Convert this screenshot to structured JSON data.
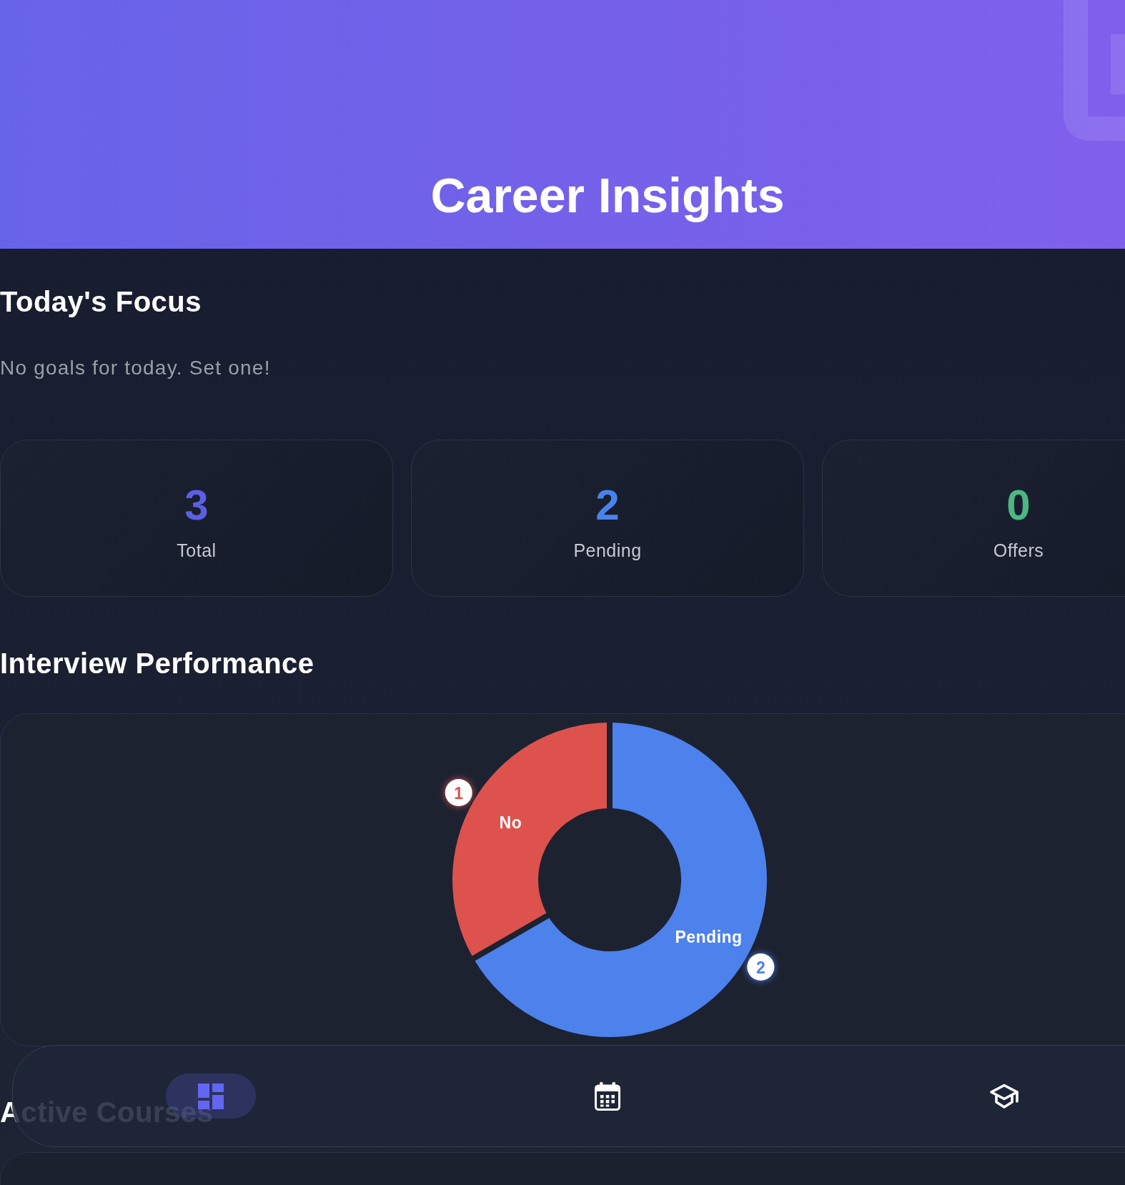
{
  "header": {
    "title": "Career Insights"
  },
  "todays_focus": {
    "heading": "Today's Focus",
    "empty_message": "No goals for today. Set one!"
  },
  "stats": [
    {
      "value": "3",
      "label": "Total",
      "color": "#5c5fe4"
    },
    {
      "value": "2",
      "label": "Pending",
      "color": "#4a82ec"
    },
    {
      "value": "0",
      "label": "Offers",
      "color": "#4cb784"
    }
  ],
  "interview_performance": {
    "heading": "Interview Performance",
    "chart_data": {
      "type": "donut",
      "categories": [
        "Pending",
        "No"
      ],
      "values": [
        2,
        1
      ],
      "colors": [
        "#4d81ec",
        "#dd524d"
      ],
      "data_labels": true
    }
  },
  "active_courses": {
    "heading": "Active Courses"
  },
  "bottom_nav": {
    "items": [
      {
        "selected": true
      },
      {
        "selected": false
      },
      {
        "selected": false
      }
    ]
  }
}
